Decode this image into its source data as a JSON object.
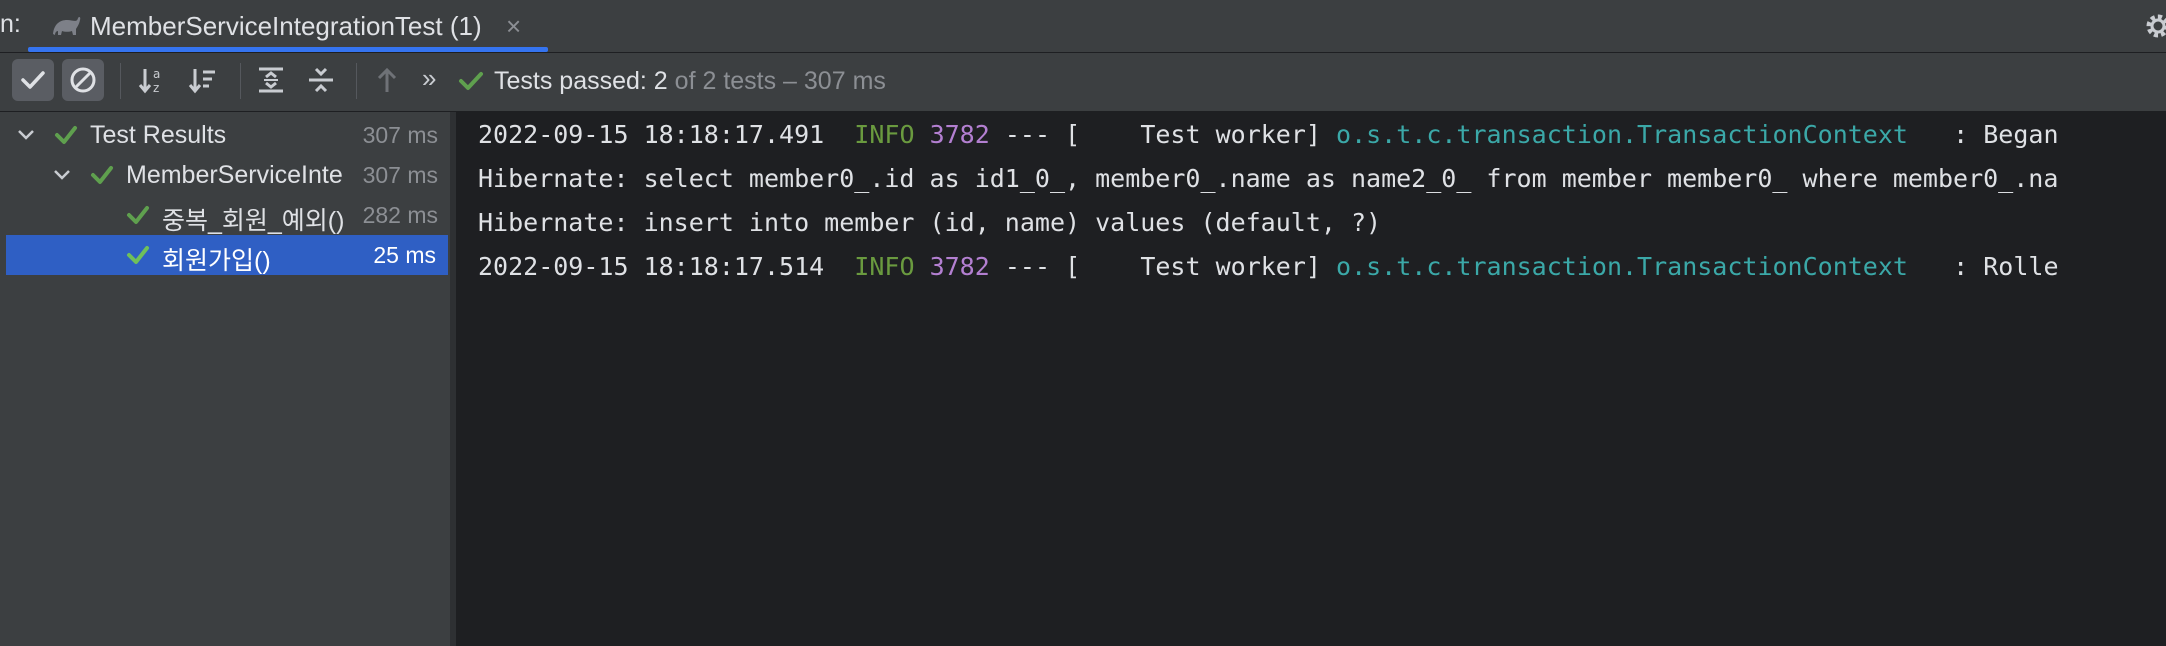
{
  "tabbar": {
    "run_label": "n:",
    "tab_title": "MemberServiceIntegrationTest (1)",
    "tab_close": "×"
  },
  "toolbar": {
    "status_prefix": "Tests passed: 2",
    "status_suffix": "of 2 tests – 307 ms",
    "more_label": "»"
  },
  "tree": {
    "rows": [
      {
        "label": "Test Results",
        "time": "307 ms"
      },
      {
        "label": "MemberServiceInte",
        "time": "307 ms"
      },
      {
        "label": "중복_회원_예외()",
        "time": "282 ms"
      },
      {
        "label": "회원가입()",
        "time": "25 ms"
      }
    ]
  },
  "console": {
    "lines": [
      {
        "ts": "2022-09-15 18:18:17.491",
        "level": "INFO",
        "pid": "3782",
        "sep": "--- [",
        "thread": "    Test worker]",
        "logger": "o.s.t.c.transaction.TransactionContext",
        "msg": "  : Began"
      },
      {
        "text": "Hibernate: select member0_.id as id1_0_, member0_.name as name2_0_ from member member0_ where member0_.na"
      },
      {
        "text": "Hibernate: insert into member (id, name) values (default, ?)"
      },
      {
        "ts": "2022-09-15 18:18:17.514",
        "level": "INFO",
        "pid": "3782",
        "sep": "--- [",
        "thread": "    Test worker]",
        "logger": "o.s.t.c.transaction.TransactionContext",
        "msg": "  : Rolle"
      }
    ]
  },
  "colors": {
    "accent": "#3574f0",
    "selection": "#2f5fc4",
    "pass_green": "#5fa04e",
    "info": "#6a9a3f",
    "pid": "#b37fd1",
    "logger": "#3ba8a8"
  },
  "icons": [
    "gradle-icon",
    "gear-icon",
    "show-passed-icon",
    "show-ignored-icon",
    "sort-alpha-icon",
    "sort-duration-icon",
    "expand-all-icon",
    "collapse-all-icon",
    "previous-failed-icon",
    "check-icon",
    "chevron-down-icon"
  ]
}
